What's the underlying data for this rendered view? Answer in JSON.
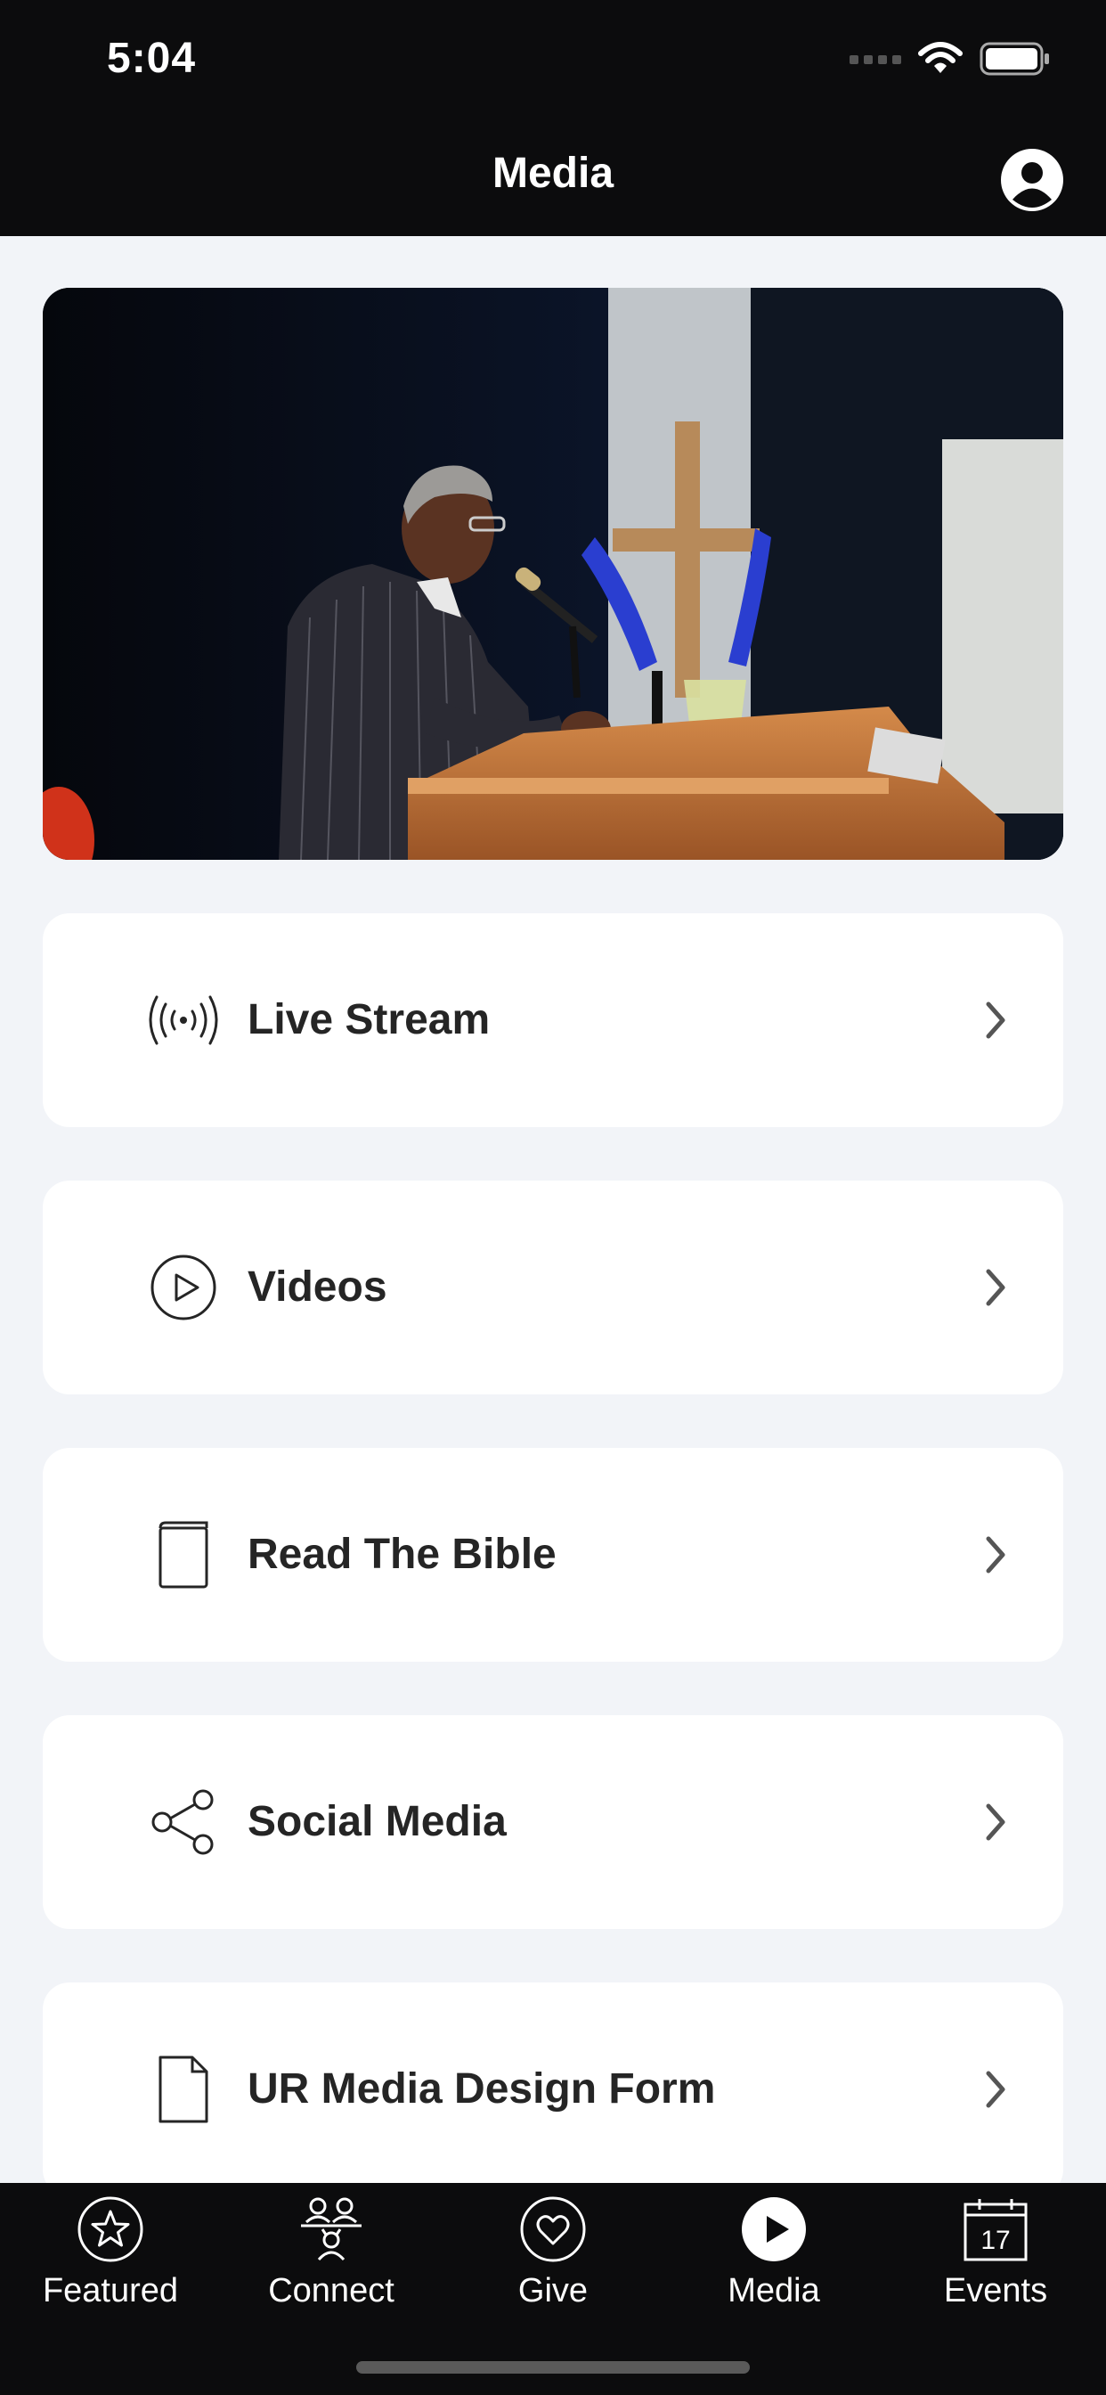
{
  "status_bar": {
    "time": "5:04"
  },
  "nav": {
    "title": "Media",
    "profile_icon": "person-circle-icon"
  },
  "hero": {
    "description_icon": "photo"
  },
  "menu": [
    {
      "label": "Live Stream",
      "icon": "broadcast-icon"
    },
    {
      "label": "Videos",
      "icon": "play-circle-icon"
    },
    {
      "label": "Read The Bible",
      "icon": "book-icon"
    },
    {
      "label": "Social Media",
      "icon": "share-icon"
    },
    {
      "label": "UR Media Design Form",
      "icon": "document-icon"
    }
  ],
  "tabs": [
    {
      "label": "Featured",
      "icon": "star-circle-icon"
    },
    {
      "label": "Connect",
      "icon": "people-icon"
    },
    {
      "label": "Give",
      "icon": "heart-circle-icon"
    },
    {
      "label": "Media",
      "icon": "play-filled-circle-icon",
      "active": true
    },
    {
      "label": "Events",
      "icon": "calendar-icon",
      "calendar_day": "17"
    }
  ],
  "colors": {
    "bar_bg": "#0c0c0d",
    "page_bg": "#f2f4f8",
    "card_bg": "#ffffff",
    "text": "#252525"
  }
}
